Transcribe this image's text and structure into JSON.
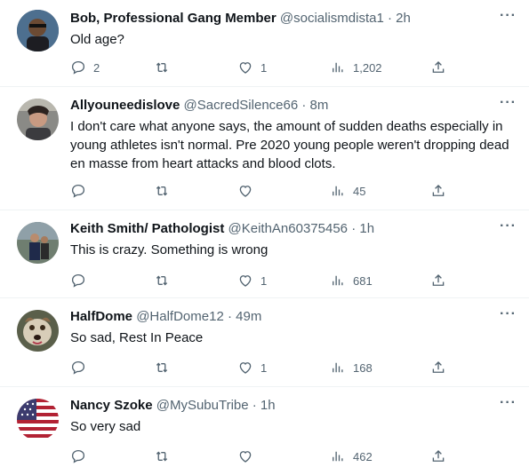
{
  "tweets": [
    {
      "name": "Bob, Professional Gang Member",
      "handle": "@socialismdista1",
      "time": "· 2h",
      "text": "Old age?",
      "replies": "2",
      "retweets": "",
      "likes": "1",
      "views": "1,202"
    },
    {
      "name": "Allyouneedislove",
      "handle": "@SacredSilence66",
      "time": "· 8m",
      "text": "I don't care what anyone says, the amount of sudden deaths especially in young athletes isn't normal. Pre 2020 young people weren't dropping dead en masse from heart attacks and blood clots.",
      "replies": "",
      "retweets": "",
      "likes": "",
      "views": "45"
    },
    {
      "name": "Keith Smith/ Pathologist",
      "handle": "@KeithAn60375456",
      "time": "· 1h",
      "text": "This is crazy. Something is wrong",
      "replies": "",
      "retweets": "",
      "likes": "1",
      "views": "681"
    },
    {
      "name": "HalfDome",
      "handle": "@HalfDome12",
      "time": "· 49m",
      "text": "So sad, Rest In Peace",
      "replies": "",
      "retweets": "",
      "likes": "1",
      "views": "168"
    },
    {
      "name": "Nancy Szoke",
      "handle": "@MySubuTribe",
      "time": "· 1h",
      "text": "So very sad",
      "replies": "",
      "retweets": "",
      "likes": "",
      "views": "462"
    }
  ],
  "icons": {
    "reply": "reply-icon",
    "retweet": "retweet-icon",
    "like": "heart-icon",
    "views": "views-icon",
    "share": "share-icon",
    "more": "more-icon"
  },
  "colors": {
    "text": "#0f1419",
    "secondary": "#536471",
    "divider": "#eff3f4"
  }
}
